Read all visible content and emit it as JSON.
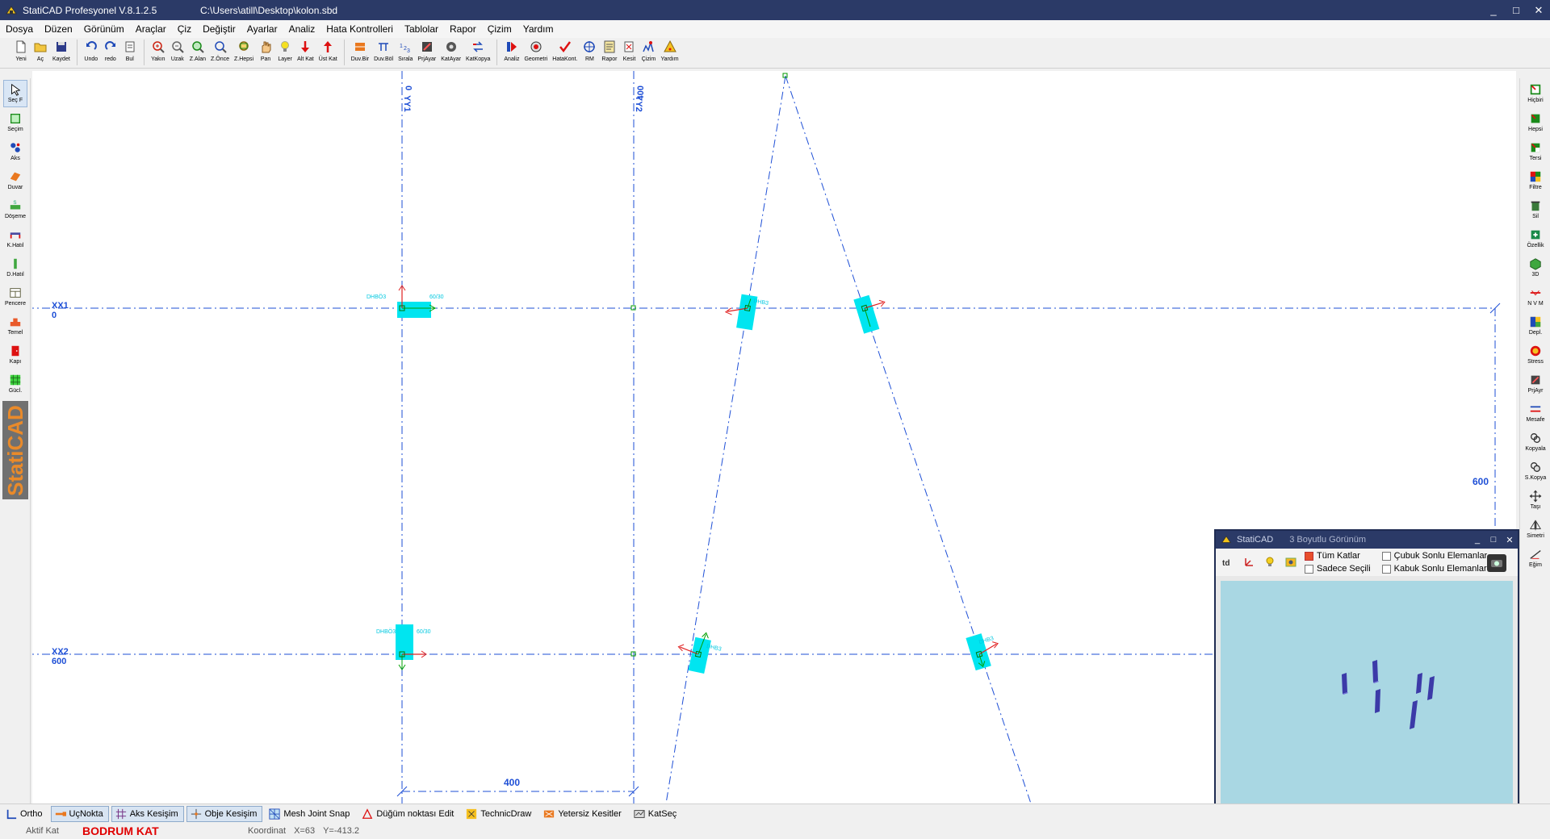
{
  "window": {
    "title": "StatiCAD Profesyonel V.8.1.2.5",
    "file_path": "C:\\Users\\atill\\Desktop\\kolon.sbd",
    "controls": [
      "_",
      "□",
      "✕"
    ]
  },
  "menu": [
    "Dosya",
    "Düzen",
    "Görünüm",
    "Araçlar",
    "Çiz",
    "Değiştir",
    "Ayarlar",
    "Analiz",
    "Hata Kontrolleri",
    "Tablolar",
    "Rapor",
    "Çizim",
    "Yardım"
  ],
  "toolbar": {
    "groups": [
      [
        {
          "label": "Yeni",
          "icon": "new-file-icon"
        },
        {
          "label": "Aç",
          "icon": "open-folder-icon"
        },
        {
          "label": "Kaydet",
          "icon": "save-icon"
        }
      ],
      [
        {
          "label": "Undo",
          "icon": "undo-icon"
        },
        {
          "label": "redo",
          "icon": "redo-icon"
        },
        {
          "label": "Bul",
          "icon": "find-icon"
        }
      ],
      [
        {
          "label": "Yakın",
          "icon": "zoom-in-icon"
        },
        {
          "label": "Uzak",
          "icon": "zoom-out-icon"
        },
        {
          "label": "Z.Alan",
          "icon": "zoom-area-icon"
        },
        {
          "label": "Z.Önce",
          "icon": "zoom-previous-icon"
        },
        {
          "label": "Z.Hepsi",
          "icon": "zoom-all-icon"
        },
        {
          "label": "Pan",
          "icon": "pan-hand-icon"
        },
        {
          "label": "Layer",
          "icon": "layer-bulb-icon"
        },
        {
          "label": "Alt Kat",
          "icon": "lower-floor-icon"
        },
        {
          "label": "Üst Kat",
          "icon": "upper-floor-icon"
        }
      ],
      [
        {
          "label": "Duv.Bir",
          "icon": "wall-join-icon"
        },
        {
          "label": "Duv.Böl",
          "icon": "wall-split-icon"
        },
        {
          "label": "Sırala",
          "icon": "sort-icon"
        },
        {
          "label": "PrjAyar",
          "icon": "project-settings-icon"
        },
        {
          "label": "KatAyar",
          "icon": "floor-settings-icon"
        },
        {
          "label": "KatKopya",
          "icon": "floor-copy-icon"
        }
      ],
      [
        {
          "label": "Analiz",
          "icon": "analysis-icon"
        },
        {
          "label": "Geometri",
          "icon": "geometry-icon"
        },
        {
          "label": "HataKont.",
          "icon": "error-check-icon"
        },
        {
          "label": "RM",
          "icon": "rm-target-icon"
        },
        {
          "label": "Rapor",
          "icon": "report-icon"
        },
        {
          "label": "Kesit",
          "icon": "section-icon"
        },
        {
          "label": "Çizim",
          "icon": "drawing-icon"
        },
        {
          "label": "Yardım",
          "icon": "help-icon"
        }
      ]
    ]
  },
  "left_tools": [
    {
      "label": "Seç F",
      "icon": "select-arrow-icon"
    },
    {
      "label": "Seçim",
      "icon": "selection-icon"
    },
    {
      "label": "Aks",
      "icon": "axis-icon"
    },
    {
      "label": "Duvar",
      "icon": "wall-icon"
    },
    {
      "label": "Döşeme",
      "icon": "slab-icon"
    },
    {
      "label": "K.Hatıl",
      "icon": "horizontal-beam-icon"
    },
    {
      "label": "D.Hatıl",
      "icon": "vertical-beam-icon"
    },
    {
      "label": "Pencere",
      "icon": "window-icon"
    },
    {
      "label": "Temel",
      "icon": "foundation-icon"
    },
    {
      "label": "Kapı",
      "icon": "door-icon"
    },
    {
      "label": "Gücl.",
      "icon": "strengthening-icon"
    }
  ],
  "brand": "StatiCAD",
  "right_tools": [
    {
      "label": "Hiçbiri",
      "icon": "select-none-icon"
    },
    {
      "label": "Hepsi",
      "icon": "select-all-icon"
    },
    {
      "label": "Tersi",
      "icon": "invert-selection-icon"
    },
    {
      "label": "Filtre",
      "icon": "filter-icon"
    },
    {
      "label": "Sil",
      "icon": "delete-icon"
    },
    {
      "label": "Özellik",
      "icon": "properties-icon"
    },
    {
      "label": "3D",
      "icon": "3d-view-icon"
    },
    {
      "label": "N V M",
      "icon": "nvm-icon"
    },
    {
      "label": "Depl.",
      "icon": "displacement-icon"
    },
    {
      "label": "Stress",
      "icon": "stress-icon"
    },
    {
      "label": "PrjAyr",
      "icon": "project-settings-icon"
    },
    {
      "label": "Mesafe",
      "icon": "distance-icon"
    },
    {
      "label": "Kopyala",
      "icon": "copy-icon"
    },
    {
      "label": "S.Kopya",
      "icon": "special-copy-icon"
    },
    {
      "label": "Taşı",
      "icon": "move-icon"
    },
    {
      "label": "Simetri",
      "icon": "mirror-icon"
    },
    {
      "label": "Eğim",
      "icon": "slope-icon"
    }
  ],
  "drawing": {
    "axes": {
      "yy1": "YY1",
      "yy1_val": "0",
      "yy2": "YY2",
      "yy2_val": "400",
      "xx1": "XX1",
      "xx1_val": "0",
      "xx2": "XX2",
      "xx2_val": "600"
    },
    "dimensions": {
      "horizontal": "400",
      "vertical": "600"
    },
    "column_labels": {
      "c1_name": "DHBÖ3",
      "c1_size": "60/30",
      "c2_name": "DHBÖ3",
      "c2_size": "60/30",
      "c3_name": "DHB3",
      "c3_size": "60/30",
      "c4_name": "DHB3",
      "c4_size": "60/30",
      "c5_name": "DHB3",
      "c5_size": "60/30",
      "c6_name": "DHB3",
      "c6_size": "60/30"
    }
  },
  "view3d": {
    "app": "StatiCAD",
    "title": "3 Boyutlu Görünüm",
    "options": {
      "tum_katlar": "Tüm Katlar",
      "sadece_secili": "Sadece Seçili",
      "cubuk": "Çubuk Sonlu Elemanlar",
      "kabuk": "Kabuk Sonlu Elemanlar"
    },
    "checked": {
      "tum_katlar": true,
      "sadece_secili": false,
      "cubuk": false,
      "kabuk": false
    }
  },
  "statusbar": [
    {
      "label": "Ortho",
      "icon": "ortho-icon",
      "pressed": false
    },
    {
      "label": "UçNokta",
      "icon": "endpoint-icon",
      "pressed": true
    },
    {
      "label": "Aks Kesişim",
      "icon": "axis-intersection-icon",
      "pressed": true
    },
    {
      "label": "Obje Kesişim",
      "icon": "object-intersection-icon",
      "pressed": true
    },
    {
      "label": "Mesh Joint Snap",
      "icon": "mesh-snap-icon",
      "pressed": false
    },
    {
      "label": "Düğüm noktası Edit",
      "icon": "node-edit-icon",
      "pressed": false
    },
    {
      "label": "TechnicDraw",
      "icon": "technicdraw-icon",
      "pressed": false
    },
    {
      "label": "Yetersiz Kesitler",
      "icon": "insufficient-sections-icon",
      "pressed": false
    },
    {
      "label": "KatSeç",
      "icon": "floor-select-icon",
      "pressed": false
    }
  ],
  "info": {
    "aktif_label": "Aktif Kat",
    "aktif_value": "BODRUM KAT",
    "coord_label": "Koordinat",
    "coord_x": "X=63",
    "coord_y": "Y=-413.2"
  },
  "colors": {
    "axis": "#1e4fd6",
    "column": "#00e5f0",
    "title_bar": "#2b3a67",
    "active_floor": "#e00000",
    "view3d_bg": "#a9d7e3",
    "column_3d": "#3c3aa8"
  }
}
